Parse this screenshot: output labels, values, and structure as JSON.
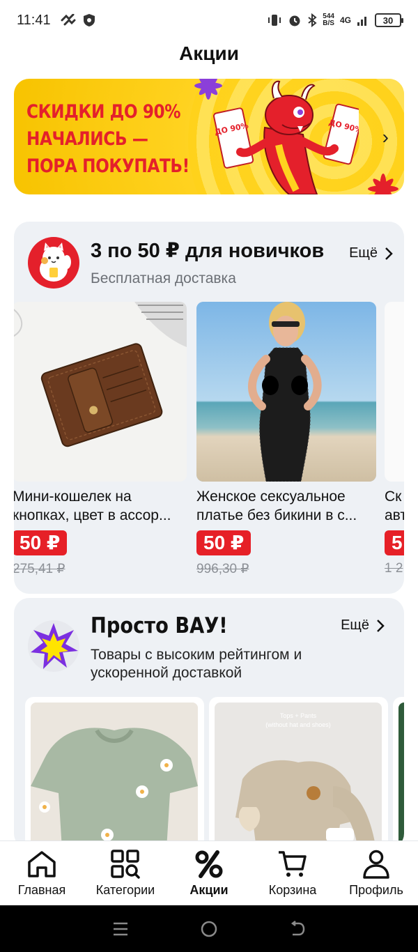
{
  "status_bar": {
    "time": "11:41",
    "net_speed_top": "544",
    "net_speed_bottom": "B/S",
    "network": "4G",
    "battery": "30"
  },
  "page": {
    "title": "Акции"
  },
  "banner": {
    "line1": "СКИДКИ ДО 90%",
    "line2": "НАЧАЛИСЬ —",
    "line3": "ПОРА ПОКУПАТЬ!",
    "tag_left": "ДО 90%",
    "tag_right": "ДО 90%"
  },
  "newcomers": {
    "title": "3 по 50 ₽ для новичков",
    "subtitle": "Бесплатная доставка",
    "more": "Ещё",
    "products": [
      {
        "name_line1": "Мини-кошелек на",
        "name_line2": "кнопках, цвет в ассор...",
        "price": "50 ₽",
        "old_price": "275,41 ₽"
      },
      {
        "name_line1": "Женское сексуальное",
        "name_line2": "платье без бикини в с...",
        "price": "50 ₽",
        "old_price": "996,30 ₽"
      },
      {
        "name_line1": "Ск",
        "name_line2": "авт",
        "price": "5",
        "old_price": "1 2"
      }
    ]
  },
  "wow": {
    "title": "Просто ВАУ!",
    "subtitle_line1": "Товары с высоким рейтингом и",
    "subtitle_line2": "ускоренной доставкой",
    "more": "Ещё",
    "products": [
      {
        "image_caption": ""
      },
      {
        "image_caption_line1": "Tops + Pants",
        "image_caption_line2": "(without hat and shoes)"
      }
    ]
  },
  "bottom_nav": [
    {
      "label": "Главная",
      "icon": "home-icon"
    },
    {
      "label": "Категории",
      "icon": "categories-icon"
    },
    {
      "label": "Акции",
      "icon": "percent-icon",
      "active": true
    },
    {
      "label": "Корзина",
      "icon": "cart-icon"
    },
    {
      "label": "Профиль",
      "icon": "profile-icon"
    }
  ],
  "colors": {
    "accent_red": "#e62027",
    "banner_yellow": "#ffd21f",
    "card_bg": "#eef1f5"
  }
}
